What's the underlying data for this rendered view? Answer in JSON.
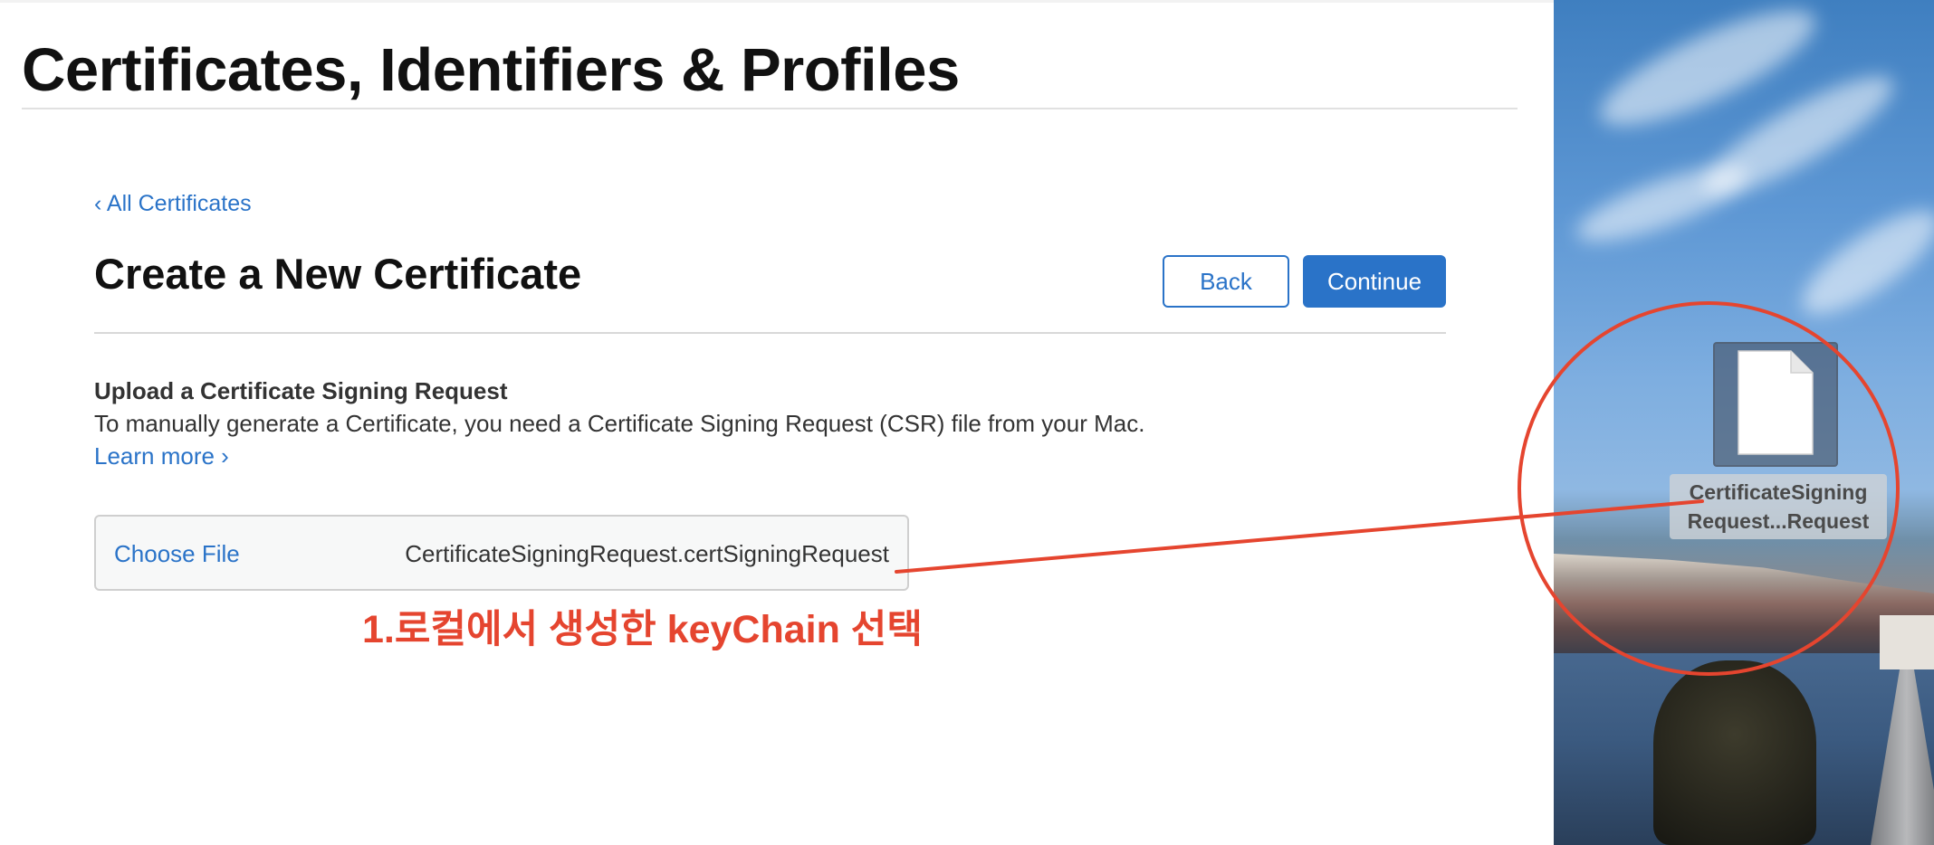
{
  "header": {
    "title": "Certificates, Identifiers & Profiles"
  },
  "nav": {
    "back_link": "‹ All Certificates"
  },
  "main": {
    "section_title": "Create a New Certificate",
    "back_button": "Back",
    "continue_button": "Continue",
    "upload": {
      "heading": "Upload a Certificate Signing Request",
      "description": "To manually generate a Certificate, you need a Certificate Signing Request (CSR) file from your Mac.",
      "learn_more": "Learn more ›",
      "choose_file": "Choose File",
      "file_name": "CertificateSigningRequest.certSigningRequest"
    }
  },
  "annotation": {
    "text": "1.로컬에서 생성한 keyChain 선택",
    "color": "#e5452f"
  },
  "desktop": {
    "file_label_line1": "CertificateSigning",
    "file_label_line2": "Request...Request",
    "file_icon": "document-icon"
  },
  "colors": {
    "link": "#2a73c8",
    "primary_button": "#2a73c8"
  }
}
